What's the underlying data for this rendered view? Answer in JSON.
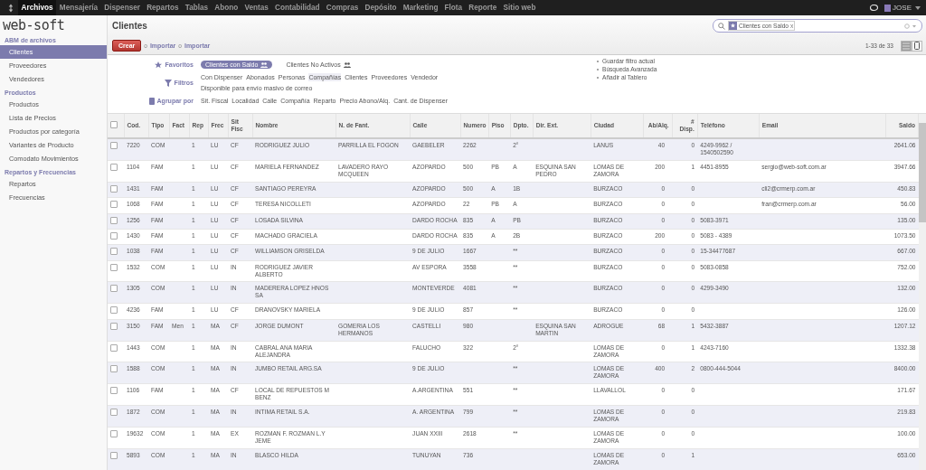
{
  "top_menu": [
    {
      "label": "Archivos",
      "selected": true
    },
    {
      "label": "Mensajería",
      "selected": false
    },
    {
      "label": "Dispenser",
      "selected": false
    },
    {
      "label": "Repartos",
      "selected": false
    },
    {
      "label": "Tablas",
      "selected": false
    },
    {
      "label": "Abono",
      "selected": false
    },
    {
      "label": "Ventas",
      "selected": false
    },
    {
      "label": "Contabilidad",
      "selected": false
    },
    {
      "label": "Compras",
      "selected": false
    },
    {
      "label": "Depósito",
      "selected": false
    },
    {
      "label": "Marketing",
      "selected": false
    },
    {
      "label": "Flota",
      "selected": false
    },
    {
      "label": "Reporte",
      "selected": false
    },
    {
      "label": "Sitio web",
      "selected": false
    }
  ],
  "user": "JOSE",
  "logo": "web-soft",
  "sidebar": [
    {
      "title": "ABM de archivos",
      "items": [
        {
          "label": "Clientes",
          "selected": true
        },
        {
          "label": "Proveedores",
          "selected": false
        },
        {
          "label": "Vendedores",
          "selected": false
        }
      ]
    },
    {
      "title": "Productos",
      "items": [
        {
          "label": "Productos",
          "selected": false
        },
        {
          "label": "Lista de Precios",
          "selected": false
        },
        {
          "label": "Productos por categoría",
          "selected": false
        },
        {
          "label": "Variantes de Producto",
          "selected": false
        },
        {
          "label": "Comodato Movimientos",
          "selected": false
        }
      ]
    },
    {
      "title": "Repartos y Frecuencias",
      "items": [
        {
          "label": "Repartos",
          "selected": false
        },
        {
          "label": "Frecuencias",
          "selected": false
        }
      ]
    }
  ],
  "page_title": "Clientes",
  "create_button": "Crear",
  "import_links": [
    {
      "sep": "o",
      "label": "Importar"
    },
    {
      "sep": "o",
      "label": "Importar"
    }
  ],
  "search": {
    "facet": "Clientes con Saldo",
    "remove": "x"
  },
  "pager": "1-33 de 33",
  "views": [
    {
      "kind": "list",
      "selected": true
    },
    {
      "kind": "kanban",
      "selected": false
    }
  ],
  "favorites": {
    "label": "Favoritos",
    "items": [
      {
        "label": "Clientes con Saldo",
        "selected": true
      },
      {
        "label": "Clientes No Activos",
        "selected": false
      }
    ]
  },
  "filters": {
    "label": "Filtros",
    "items": [
      {
        "label": "Con Dispenser",
        "selected": false
      },
      {
        "label": "Abonados",
        "selected": false
      },
      {
        "label": "Personas",
        "selected": false
      },
      {
        "label": "Compañías",
        "selected": true
      },
      {
        "label": "Clientes",
        "selected": false
      },
      {
        "label": "Proveedores",
        "selected": false
      },
      {
        "label": "Vendedor",
        "selected": false
      },
      {
        "label": "Disponible para envío masivo de correo",
        "selected": false
      }
    ]
  },
  "group_by": {
    "label": "Agrupar por",
    "items": [
      "Sit. Fiscal",
      "Localidad",
      "Calle",
      "Compañía",
      "Reparto",
      "Precio Abono/Alq.",
      "Cant. de Dispenser"
    ]
  },
  "filter_actions": [
    "Guardar filtro actual",
    "Búsqueda Avanzada",
    "Añadir al Tablero"
  ],
  "table": {
    "select_all": {
      "checked": false
    },
    "columns": [
      "Cod.",
      "Tipo",
      "Fact",
      "Rep",
      "Frec",
      "Sit Fisc",
      "Nombre",
      "N. de Fant.",
      "Calle",
      "Numero",
      "Piso",
      "Dpto.",
      "Dir. Ext.",
      "Ciudad",
      "Ab/Alq.",
      "# Disp.",
      "Teléfono",
      "Email",
      "Saldo"
    ],
    "rows": [
      {
        "checked": false,
        "cod": "7220",
        "tipo": "COM",
        "rep": "1",
        "frec": "LU",
        "sit": "CF",
        "nombre": "RODRIGUEZ JULIO",
        "fant": "PARRILLA EL FOGON",
        "calle": "GAEBELER",
        "numero": "2262",
        "dpto": "2°",
        "ciudad": "LANUS",
        "ab": "40",
        "disp": "0",
        "tel": "4249-9962 / 1540502590",
        "saldo": "2641.06"
      },
      {
        "checked": false,
        "cod": "1104",
        "tipo": "FAM",
        "rep": "1",
        "frec": "LU",
        "sit": "CF",
        "nombre": "MARIELA FERNANDEZ",
        "fant": "LAVADERO RAYO MCQUEEN",
        "calle": "AZOPARDO",
        "numero": "500",
        "piso": "PB",
        "dpto": "A",
        "dir": "ESQUINA SAN PEDRO",
        "ciudad": "LOMAS DE ZAMORA",
        "ab": "200",
        "disp": "1",
        "tel": "4451-8955",
        "email": "sergio@web-soft.com.ar",
        "saldo": "3947.66"
      },
      {
        "checked": false,
        "cod": "1431",
        "tipo": "FAM",
        "rep": "1",
        "frec": "LU",
        "sit": "CF",
        "nombre": "SANTIAGO PEREYRA",
        "calle": "AZOPARDO",
        "numero": "500",
        "piso": "A",
        "dpto": "1B",
        "ciudad": "BURZACO",
        "ab": "0",
        "disp": "0",
        "email": "cli2@crmerp.com.ar",
        "saldo": "450.83"
      },
      {
        "checked": false,
        "cod": "1068",
        "tipo": "FAM",
        "rep": "1",
        "frec": "LU",
        "sit": "CF",
        "nombre": "TERESA NICOLLETI",
        "calle": "AZOPARDO",
        "numero": "22",
        "piso": "PB",
        "dpto": "A",
        "ciudad": "BURZACO",
        "ab": "0",
        "disp": "0",
        "email": "fran@crmerp.com.ar",
        "saldo": "56.00"
      },
      {
        "checked": false,
        "cod": "1256",
        "tipo": "FAM",
        "rep": "1",
        "frec": "LU",
        "sit": "CF",
        "nombre": "LOSADA SILVINA",
        "calle": "DARDO ROCHA",
        "numero": "835",
        "piso": "A",
        "dpto": "PB",
        "ciudad": "BURZACO",
        "ab": "0",
        "disp": "0",
        "tel": "5083-3971",
        "saldo": "135.00"
      },
      {
        "checked": false,
        "cod": "1430",
        "tipo": "FAM",
        "rep": "1",
        "frec": "LU",
        "sit": "CF",
        "nombre": "MACHADO GRACIELA",
        "calle": "DARDO ROCHA",
        "numero": "835",
        "piso": "A",
        "dpto": "2B",
        "ciudad": "BURZACO",
        "ab": "200",
        "disp": "0",
        "tel": "5083 - 4389",
        "saldo": "1073.50"
      },
      {
        "checked": false,
        "cod": "1038",
        "tipo": "FAM",
        "rep": "1",
        "frec": "LU",
        "sit": "CF",
        "nombre": "WILLIAMSON GRISELDA",
        "calle": "9 DE JULIO",
        "numero": "1667",
        "dpto": "**",
        "ciudad": "BURZACO",
        "ab": "0",
        "disp": "0",
        "tel": "15-34477687",
        "saldo": "667.00"
      },
      {
        "checked": false,
        "cod": "1532",
        "tipo": "COM",
        "rep": "1",
        "frec": "LU",
        "sit": "IN",
        "nombre": "RODRIGUEZ JAVIER ALBERTO",
        "calle": "AV ESPORA",
        "numero": "3558",
        "dpto": "**",
        "ciudad": "BURZACO",
        "ab": "0",
        "disp": "0",
        "tel": "5083-0858",
        "saldo": "752.00"
      },
      {
        "checked": false,
        "cod": "1305",
        "tipo": "COM",
        "rep": "1",
        "frec": "LU",
        "sit": "IN",
        "nombre": "MADERERA LOPEZ HNOS SA",
        "calle": "MONTEVERDE",
        "numero": "4081",
        "dpto": "**",
        "ciudad": "BURZACO",
        "ab": "0",
        "disp": "0",
        "tel": "4299-3490",
        "saldo": "132.00"
      },
      {
        "checked": false,
        "cod": "4236",
        "tipo": "FAM",
        "rep": "1",
        "frec": "LU",
        "sit": "CF",
        "nombre": "DRANOVSKY MARIELA",
        "calle": "9 DE JULIO",
        "numero": "857",
        "dpto": "**",
        "ciudad": "BURZACO",
        "ab": "0",
        "disp": "0",
        "saldo": "126.00"
      },
      {
        "checked": false,
        "cod": "3150",
        "tipo": "FAM",
        "fact": "Men",
        "rep": "1",
        "frec": "MA",
        "sit": "CF",
        "nombre": "JORGE DUMONT",
        "fant": "GOMERIA LOS HERMANOS",
        "calle": "CASTELLI",
        "numero": "980",
        "dir": "ESQUINA SAN MARTIN",
        "ciudad": "ADROGUE",
        "ab": "68",
        "disp": "1",
        "tel": "5432-3887",
        "saldo": "1207.12"
      },
      {
        "checked": false,
        "cod": "1443",
        "tipo": "COM",
        "rep": "1",
        "frec": "MA",
        "sit": "IN",
        "nombre": "CABRAL ANA MARIA ALEJANDRA",
        "calle": "FALUCHO",
        "numero": "322",
        "dpto": "2°",
        "ciudad": "LOMAS DE ZAMORA",
        "ab": "0",
        "disp": "1",
        "tel": "4243-7160",
        "saldo": "1332.38"
      },
      {
        "checked": false,
        "cod": "1588",
        "tipo": "COM",
        "rep": "1",
        "frec": "MA",
        "sit": "IN",
        "nombre": "JUMBO RETAIL ARG.SA",
        "calle": "9 DE JULIO",
        "dpto": "**",
        "ciudad": "LOMAS DE ZAMORA",
        "ab": "400",
        "disp": "2",
        "tel": "0800-444-5044",
        "saldo": "8400.00"
      },
      {
        "checked": false,
        "cod": "1106",
        "tipo": "FAM",
        "rep": "1",
        "frec": "MA",
        "sit": "CF",
        "nombre": "LOCAL DE REPUESTOS M BENZ",
        "calle": "A.ARGENTINA",
        "numero": "551",
        "dpto": "**",
        "ciudad": "LLAVALLOL",
        "ab": "0",
        "disp": "0",
        "saldo": "171.67"
      },
      {
        "checked": false,
        "cod": "1872",
        "tipo": "COM",
        "rep": "1",
        "frec": "MA",
        "sit": "IN",
        "nombre": "INTIMA RETAIL S.A.",
        "calle": "A. ARGENTINA",
        "numero": "799",
        "dpto": "**",
        "ciudad": "LOMAS DE ZAMORA",
        "ab": "0",
        "disp": "0",
        "saldo": "219.83"
      },
      {
        "checked": false,
        "cod": "19632",
        "tipo": "COM",
        "rep": "1",
        "frec": "MA",
        "sit": "EX",
        "nombre": "ROZMAN F. ROZMAN L.Y JEME",
        "calle": "JUAN XXIII",
        "numero": "2618",
        "dpto": "**",
        "ciudad": "LOMAS DE ZAMORA",
        "ab": "0",
        "disp": "0",
        "saldo": "100.00"
      },
      {
        "checked": false,
        "cod": "5893",
        "tipo": "COM",
        "rep": "1",
        "frec": "MA",
        "sit": "IN",
        "nombre": "BLASCO HILDA",
        "calle": "TUNUYAN",
        "numero": "736",
        "ciudad": "LOMAS DE ZAMORA",
        "ab": "0",
        "disp": "1",
        "saldo": "653.00"
      }
    ]
  }
}
